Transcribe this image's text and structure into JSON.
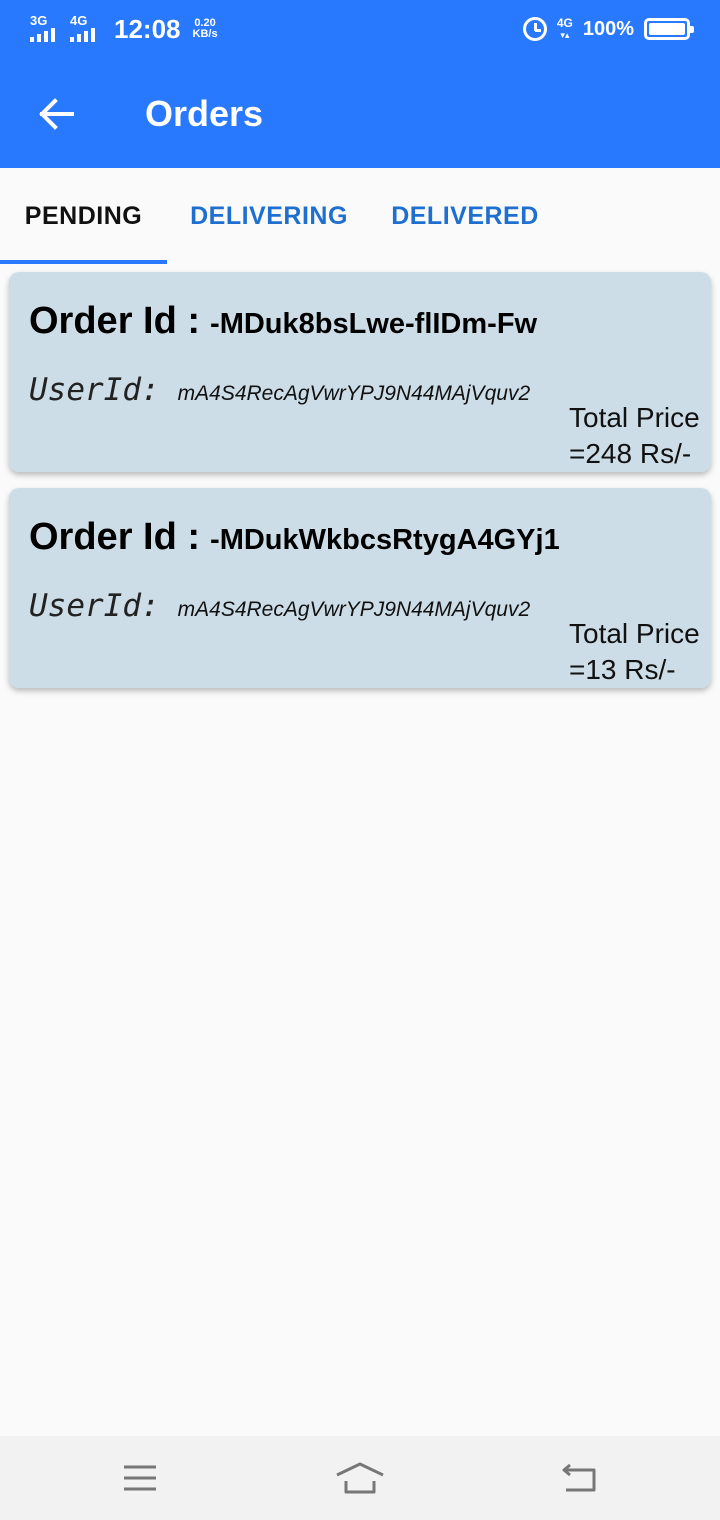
{
  "status_bar": {
    "network_1": "3G",
    "network_2": "4G",
    "time": "12:08",
    "speed_value": "0.20",
    "speed_unit": "KB/s",
    "lte": "4G",
    "battery_percent": "100%",
    "battery_level": 1.0
  },
  "header": {
    "title": "Orders",
    "back_icon": "arrow-left-icon",
    "color": "#2979ff"
  },
  "tabs": [
    {
      "label": "PENDING",
      "active": true
    },
    {
      "label": "DELIVERING",
      "active": false
    },
    {
      "label": "DELIVERED",
      "active": false
    }
  ],
  "orders": [
    {
      "order_label": "Order Id :",
      "order_id": "-MDuk8bsLwe-flIDm-Fw",
      "user_label": "UserId:",
      "user_id": "mA4S4RecAgVwrYPJ9N44MAjVquv2",
      "price_line1": "Total Price",
      "price_line2": "=248 Rs/-"
    },
    {
      "order_label": "Order Id :",
      "order_id": "-MDukWkbcsRtygA4GYj1",
      "user_label": "UserId:",
      "user_id": "mA4S4RecAgVwrYPJ9N44MAjVquv2",
      "price_line1": "Total Price",
      "price_line2": "=13 Rs/-"
    }
  ],
  "nav_bar": {
    "menu_icon": "menu-icon",
    "home_icon": "home-icon",
    "back_icon": "back-icon"
  }
}
